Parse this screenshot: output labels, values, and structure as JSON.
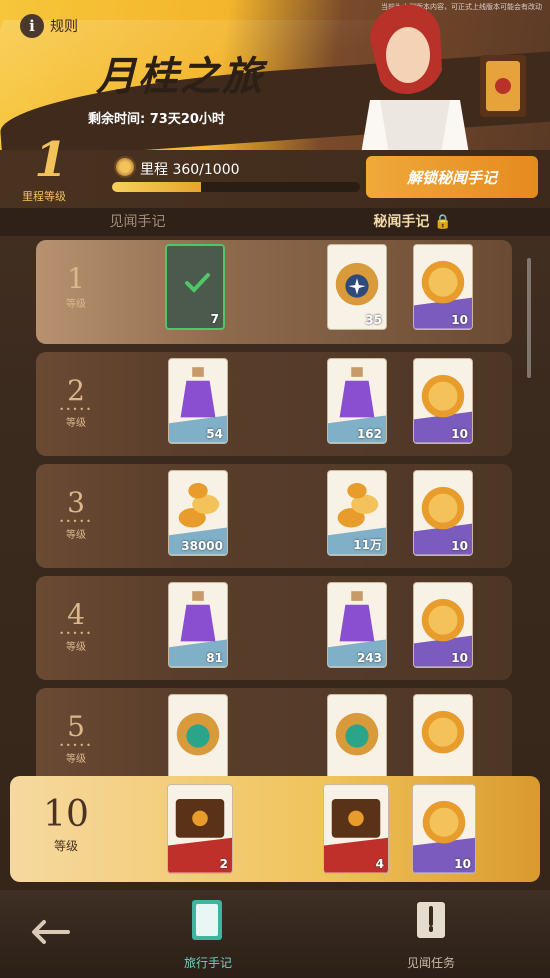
{
  "header": {
    "rules_label": "规则",
    "disclaimer": "当前为内测版本内容，可正式上线版本可能会有改动",
    "title": "月桂之旅",
    "remaining_label": "剩余时间: 73天20小时"
  },
  "level": {
    "number": "1",
    "label": "里程等级"
  },
  "mileage": {
    "label": "里程 360/1000",
    "progress_fraction": 0.36
  },
  "unlock_button": "解锁秘闻手记",
  "tabs": {
    "normal": "见闻手记",
    "secret": "秘闻手记"
  },
  "level_label": "等级",
  "rows": [
    {
      "level": "1",
      "normal_qty": "7",
      "secret1_qty": "35",
      "secret2_qty": "10",
      "claimed": true
    },
    {
      "level": "2",
      "normal_qty": "54",
      "secret1_qty": "162",
      "secret2_qty": "10"
    },
    {
      "level": "3",
      "normal_qty": "38000",
      "secret1_qty": "11万",
      "secret2_qty": "10"
    },
    {
      "level": "4",
      "normal_qty": "81",
      "secret1_qty": "243",
      "secret2_qty": "10"
    },
    {
      "level": "5",
      "normal_qty": "",
      "secret1_qty": "",
      "secret2_qty": ""
    }
  ],
  "final_row": {
    "level": "10",
    "label": "等级",
    "normal_qty": "2",
    "secret1_qty": "4",
    "secret2_qty": "10"
  },
  "nav": {
    "travel_notes": "旅行手记",
    "tasks": "见闻任务"
  },
  "colors": {
    "accent_gold": "#f3c25a",
    "claimed_green": "#4ec76a",
    "nav_active": "#6fd1c0"
  }
}
